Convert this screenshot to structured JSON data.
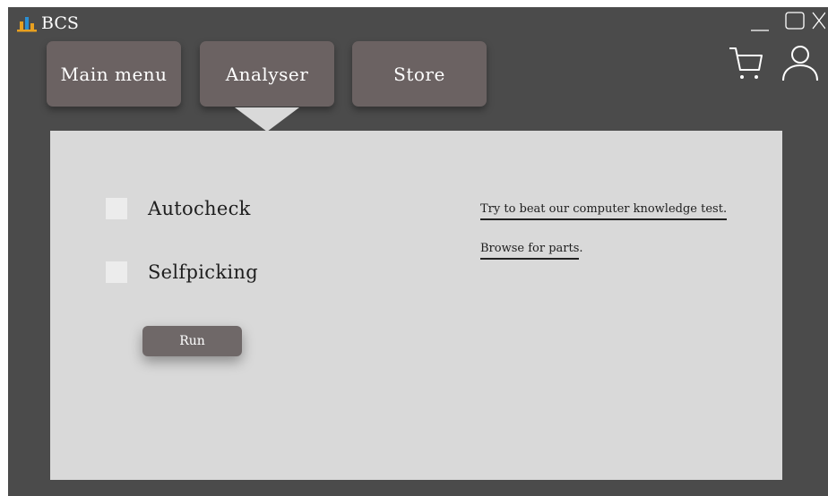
{
  "app": {
    "title": "BCS",
    "logo_icon": "bar-chart-icon"
  },
  "window_controls": {
    "minimize_icon": "minimize-icon",
    "maximize_icon": "maximize-icon",
    "close_icon": "close-icon"
  },
  "nav": {
    "tabs": [
      {
        "label": "Main menu"
      },
      {
        "label": "Analyser",
        "active": true
      },
      {
        "label": "Store"
      }
    ]
  },
  "header_icons": {
    "cart": "cart-icon",
    "user": "user-icon"
  },
  "panel": {
    "options": [
      {
        "label": "Autocheck",
        "checked": false
      },
      {
        "label": "Selfpicking",
        "checked": false
      }
    ],
    "run_label": "Run",
    "links": [
      {
        "text": "Try to beat our computer knowledge test."
      },
      {
        "text": "Browse for parts",
        "suffix": "."
      }
    ]
  },
  "colors": {
    "window_bg": "#4b4b4b",
    "tab_bg": "#6b6262",
    "panel_bg": "#d9d9d9",
    "logo_bars": [
      "#e8a020",
      "#2a8fd4",
      "#e8a020"
    ]
  }
}
